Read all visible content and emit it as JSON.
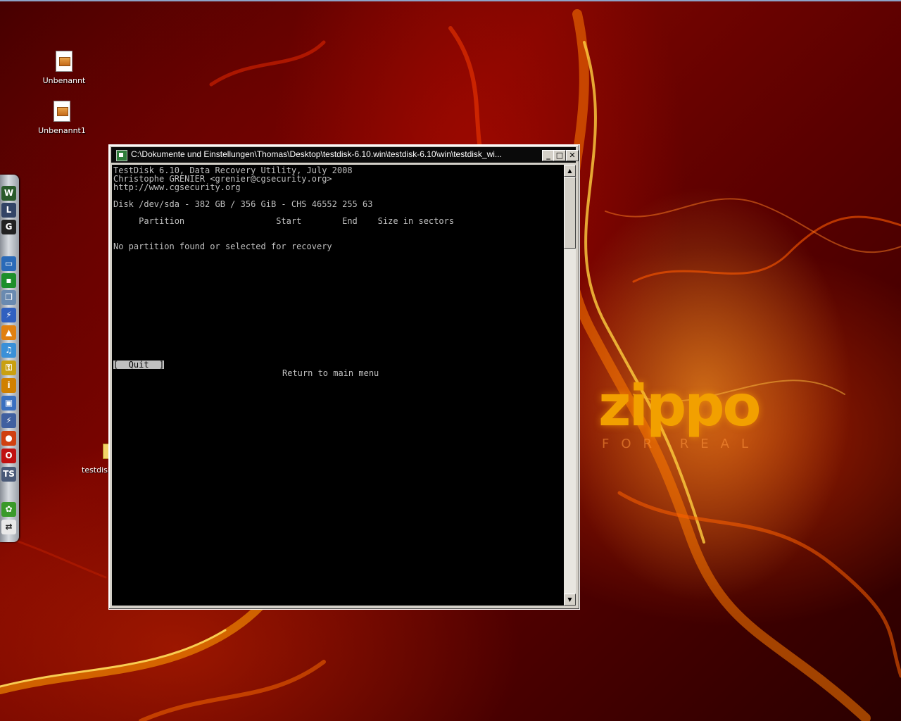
{
  "desktop": {
    "icons": [
      {
        "label": "Unbenannt"
      },
      {
        "label": "Unbenannt1"
      },
      {
        "label": "testdisk"
      }
    ],
    "wallpaper_logo": {
      "brand": "zippo",
      "tagline": "FOR REAL"
    },
    "colors": {
      "flame": "#ff8a00",
      "background": "#5a0000"
    }
  },
  "toolbar": {
    "icons": [
      "winamp-icon",
      "cover-icon",
      "gamer-icon",
      "monitor-icon",
      "network-icon",
      "copy-icon",
      "flash-icon",
      "vlc-icon",
      "itunes-icon",
      "keys-icon",
      "info-icon",
      "computer-icon",
      "lightning-icon",
      "firefox-icon",
      "opera-icon",
      "ts-icon",
      "icq-icon",
      "remote-icon"
    ]
  },
  "window": {
    "title": "C:\\Dokumente und Einstellungen\\Thomas\\Desktop\\testdisk-6.10.win\\testdisk-6.10\\win\\testdisk_wi...",
    "minimize": "_",
    "maximize": "□",
    "close": "✕",
    "console": {
      "line1": "TestDisk 6.10, Data Recovery Utility, July 2008",
      "line2": "Christophe GRENIER <grenier@cgsecurity.org>",
      "line3": "http://www.cgsecurity.org",
      "disk": "Disk /dev/sda - 382 GB / 356 GiB - CHS 46552 255 63",
      "header": "     Partition                  Start        End    Size in sectors",
      "message": "No partition found or selected for recovery",
      "quit": "[  Quit  ]",
      "hint": "Return to main menu"
    },
    "scroll": {
      "up": "▲",
      "down": "▼"
    }
  }
}
